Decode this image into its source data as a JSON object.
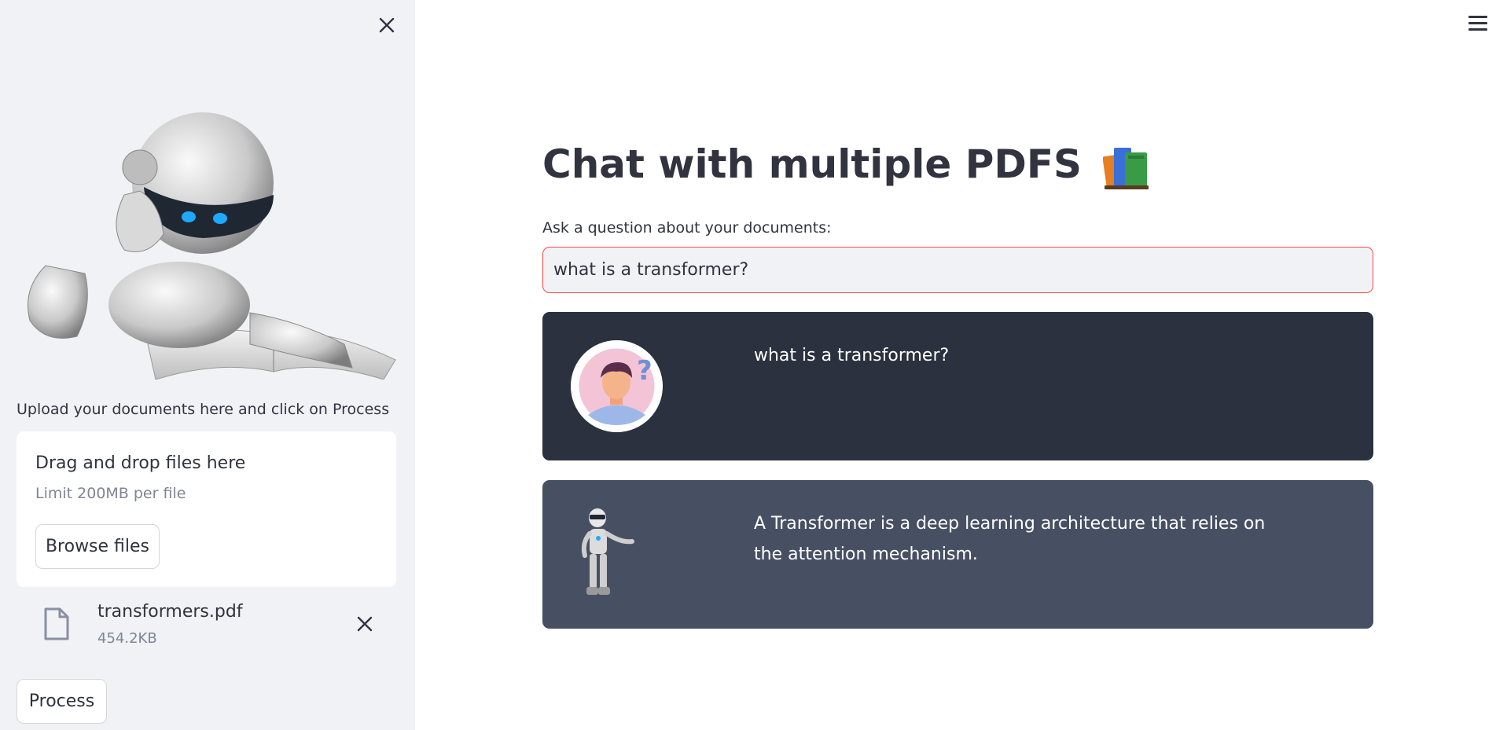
{
  "sidebar": {
    "close_icon": "close-icon",
    "upload_label": "Upload your documents here and click on Process",
    "dropzone": {
      "title": "Drag and drop files here",
      "limit": "Limit 200MB per file",
      "browse_label": "Browse files"
    },
    "file": {
      "name": "transformers.pdf",
      "size": "454.2KB"
    },
    "process_label": "Process"
  },
  "header": {
    "menu_icon": "hamburger-menu-icon"
  },
  "main": {
    "title": "Chat with multiple PDFS",
    "question_label": "Ask a question about your documents:",
    "question_value": "what is a transformer?",
    "messages": [
      {
        "role": "user",
        "text": "what is a transformer?"
      },
      {
        "role": "bot",
        "text": "A Transformer is a deep learning architecture that relies on the attention mechanism."
      }
    ]
  },
  "colors": {
    "sidebar_bg": "#f0f2f6",
    "user_msg_bg": "#2b313e",
    "bot_msg_bg": "#475063",
    "input_border": "#ff4b4b",
    "text": "#31333f",
    "muted": "#808495"
  }
}
